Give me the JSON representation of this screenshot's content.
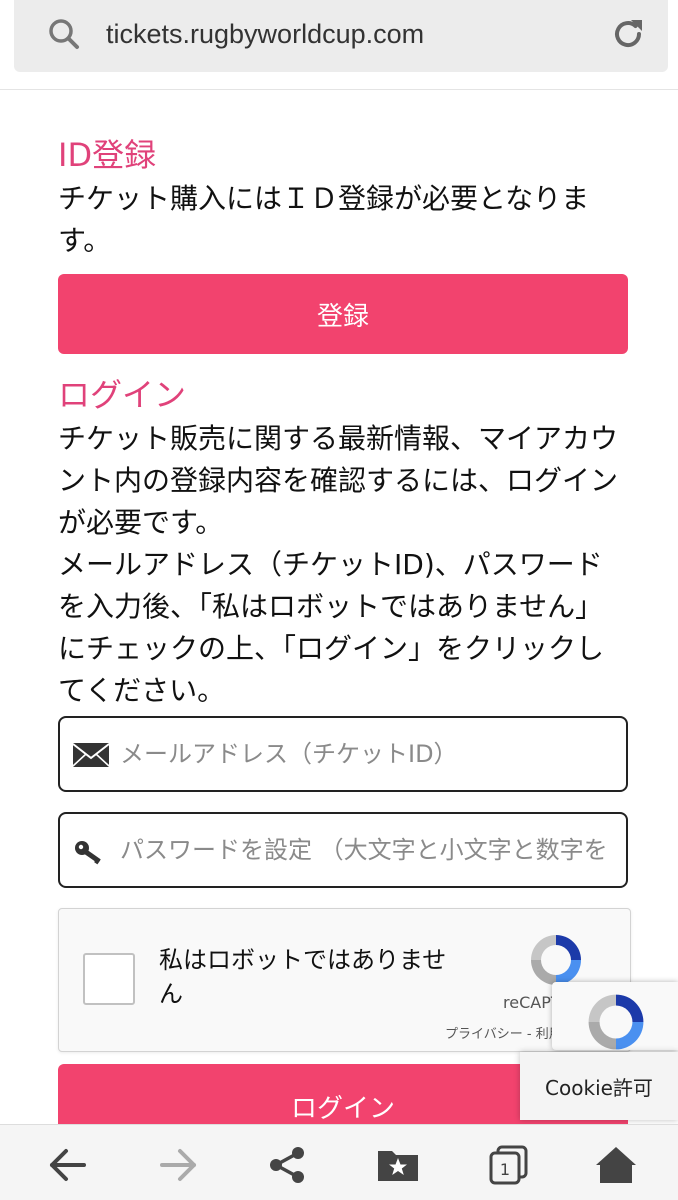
{
  "browser": {
    "url": "tickets.rugbyworldcup.com"
  },
  "register": {
    "title": "ID登録",
    "description": "チケット購入にはＩＤ登録が必要となります。",
    "button_label": "登録"
  },
  "login": {
    "title": "ログイン",
    "description_1": "チケット販売に関する最新情報、マイアカウント内の登録内容を確認するには、ログインが必要です。",
    "description_2": "メールアドレス（チケットID)、パスワードを入力後、「私はロボットではありません」にチェックの上、「ログイン」をクリックしてください。",
    "email_placeholder": "メールアドレス（チケットID）",
    "password_placeholder": "パスワードを設定 （大文字と小文字と数字を",
    "button_label": "ログイン"
  },
  "captcha": {
    "label": "私はロボットではありません",
    "brand": "reCAPTCHA",
    "links": "プライバシー - 利用規約"
  },
  "cookie": {
    "label": "Cookie許可"
  },
  "colors": {
    "accent": "#f2436e",
    "heading": "#e0427a"
  }
}
